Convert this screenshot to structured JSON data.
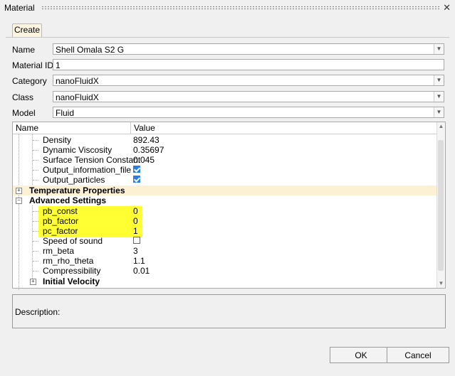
{
  "window": {
    "title": "Material"
  },
  "tabs": [
    {
      "label": "Create"
    }
  ],
  "fields": {
    "name": {
      "label": "Name",
      "value": "Shell Omala S2 G"
    },
    "material_id": {
      "label": "Material ID",
      "value": "1"
    },
    "category": {
      "label": "Category",
      "value": "nanoFluidX"
    },
    "class": {
      "label": "Class",
      "value": "nanoFluidX"
    },
    "model": {
      "label": "Model",
      "value": "Fluid"
    }
  },
  "tree": {
    "headers": {
      "name": "Name",
      "value": "Value"
    },
    "rows": {
      "density": {
        "label": "Density",
        "value": "892.43"
      },
      "dynamic_viscosity": {
        "label": "Dynamic Viscosity",
        "value": "0.35697"
      },
      "surface_tension": {
        "label": "Surface Tension Constant",
        "value": "0.045"
      },
      "output_information_file": {
        "label": "Output_information_file",
        "checked": true
      },
      "output_particles": {
        "label": "Output_particles",
        "checked": true
      },
      "temperature_properties": {
        "label": "Temperature Properties"
      },
      "advanced_settings": {
        "label": "Advanced Settings"
      },
      "pb_const": {
        "label": "pb_const",
        "value": "0"
      },
      "pb_factor": {
        "label": "pb_factor",
        "value": "0"
      },
      "pc_factor": {
        "label": "pc_factor",
        "value": "1"
      },
      "speed_of_sound": {
        "label": "Speed of sound",
        "checked": false
      },
      "rm_beta": {
        "label": "rm_beta",
        "value": "3"
      },
      "rm_rho_theta": {
        "label": "rm_rho_theta",
        "value": "1.1"
      },
      "compressibility": {
        "label": "Compressibility",
        "value": "0.01"
      },
      "initial_velocity": {
        "label": "Initial Velocity"
      }
    }
  },
  "description": {
    "label": "Description:"
  },
  "buttons": {
    "ok": "OK",
    "cancel": "Cancel"
  },
  "colors": {
    "highlight": "#ffff33",
    "group_row": "#fdf1d4",
    "checkbox": "#2a7de1"
  }
}
